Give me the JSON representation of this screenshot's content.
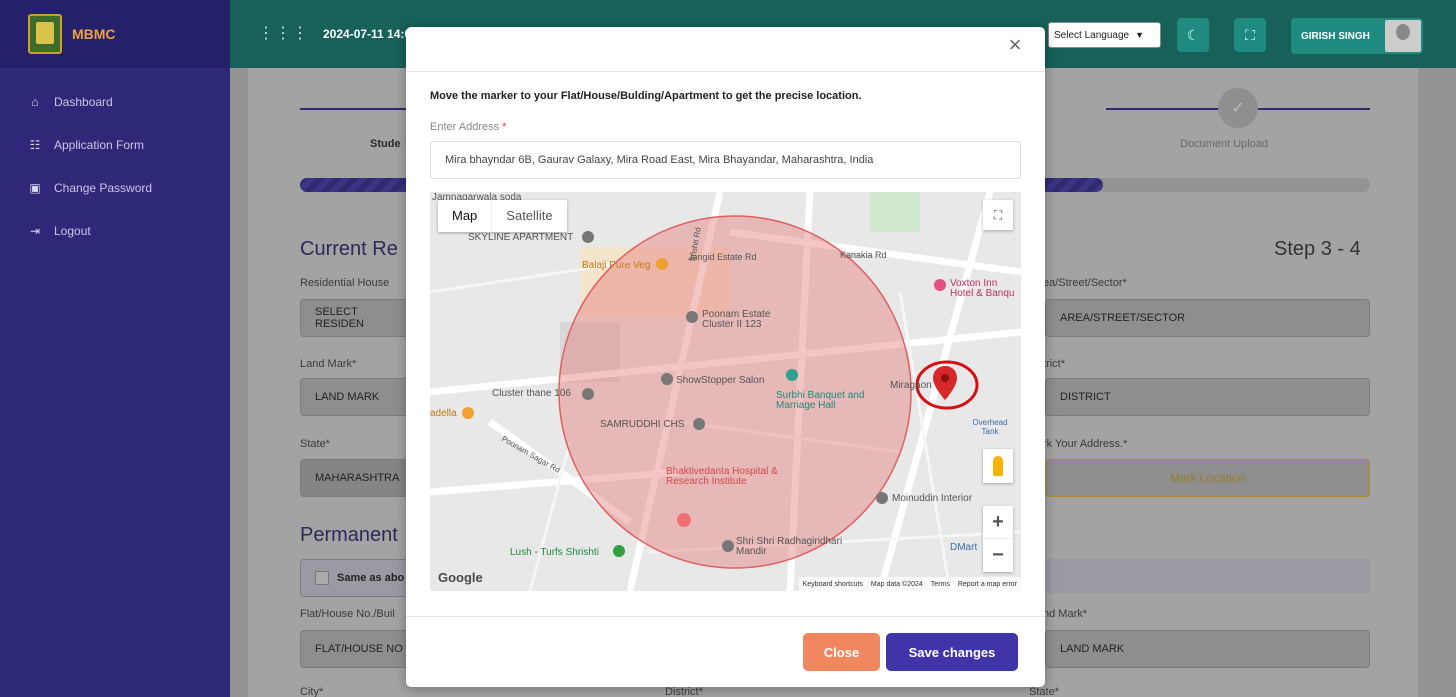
{
  "sidebar": {
    "brand": "MBMC",
    "items": [
      {
        "label": "Dashboard",
        "icon": "home-icon"
      },
      {
        "label": "Application Form",
        "icon": "form-icon"
      },
      {
        "label": "Change Password",
        "icon": "lock-icon"
      },
      {
        "label": "Logout",
        "icon": "logout-icon"
      }
    ]
  },
  "topbar": {
    "datetime": "2024-07-11 14:08",
    "language": "Select Language",
    "user": "GIRISH SINGH"
  },
  "background": {
    "step_student": "Stude",
    "step_document": "Document Upload",
    "section_current": "Current Re",
    "step_counter": "Step 3 - 4",
    "residential_label": "Residential House ",
    "residential_value": "SELECT RESIDEN",
    "area_label": "ea/Street/Sector*",
    "area_value": "AREA/STREET/SECTOR",
    "landmark_label": "Land Mark*",
    "landmark_value": "LAND MARK",
    "district_label": "trict*",
    "district_value": "DISTRICT",
    "state_label": "State*",
    "state_value": "MAHARASHTRA",
    "mark_label": "rk Your Address.*",
    "mark_button": "Mark Location",
    "section_permanent": "Permanent",
    "same_as": "Same as abo",
    "flat_label": "Flat/House No./Buil",
    "flat_value": "FLAT/HOUSE NO",
    "landmark2_label": "nd Mark*",
    "landmark2_value": "LAND MARK",
    "city_label": "City*",
    "district2_label": "District*",
    "state2_label": "State*"
  },
  "modal": {
    "instruction": "Move the marker to your Flat/House/Bulding/Apartment to get the precise location.",
    "address_label": "Enter Address",
    "address_value": "Mira bhayndar 6B, Gaurav Galaxy, Mira Road East, Mira Bhayandar, Maharashtra, India",
    "close_button": "Close",
    "save_button": "Save changes"
  },
  "map": {
    "type_map": "Map",
    "type_satellite": "Satellite",
    "google": "Google",
    "attribution": [
      "Keyboard shortcuts",
      "Map data ©2024",
      "Terms",
      "Report a map error"
    ],
    "places": [
      "Jamnagarwala soda",
      "SKYLINE APARTMENT",
      "Balaji Pure Veg",
      "Jangid Estate Rd",
      "Kanakia Rd",
      "Voxton Inn Hotel & Banqu",
      "Poonam Estate Cluster II 123",
      "ShowStopper Salon",
      "Cluster thane 106",
      "Surbhi Banquet and Marriage Hall",
      "Miragaon",
      "Overhead Tank",
      "SAMRUDDHI CHS",
      "Poonam Sagar Rd",
      "Bhaktivedanta Hospital & Research Institute",
      "Moinuddin Interior",
      "Shri Shri Radhagiridhari Mandir",
      "Lush - Turfs Shrishti",
      "DMart",
      "adella",
      "Srishti Rd"
    ]
  },
  "colors": {
    "sidebar": "#2d2878",
    "topbar": "#17615a",
    "save": "#3f35a8",
    "close": "#f0875e",
    "circle": "#e67e7e",
    "marker": "#d62828"
  }
}
